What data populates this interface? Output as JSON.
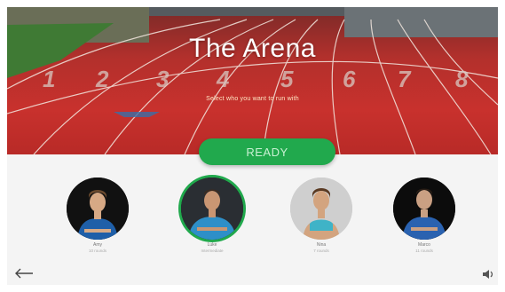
{
  "hero": {
    "title": "The Arena",
    "subtitle": "Select who you want to run with"
  },
  "ready_button": {
    "label": "READY"
  },
  "players": [
    {
      "name": "Amy",
      "role": "10 rounds",
      "shirt": "#1f5fa8",
      "bg": "dark",
      "selected": false
    },
    {
      "name": "Luke",
      "role": "Intermediate",
      "shirt": "#2e8fc8",
      "bg": "dark",
      "selected": true
    },
    {
      "name": "Nina",
      "role": "7 rounds",
      "shirt": "#3fb3c7",
      "bg": "light",
      "selected": false
    },
    {
      "name": "Marco",
      "role": "11 rounds",
      "shirt": "#2a62b0",
      "bg": "dark",
      "selected": false
    }
  ],
  "track_lane_numbers": [
    "1",
    "2",
    "3",
    "4",
    "5",
    "6",
    "7",
    "8"
  ],
  "icons": {
    "back": "arrow-left-icon",
    "sound": "speaker-icon"
  },
  "colors": {
    "accent": "#21a94d",
    "track": "#c8312d"
  }
}
